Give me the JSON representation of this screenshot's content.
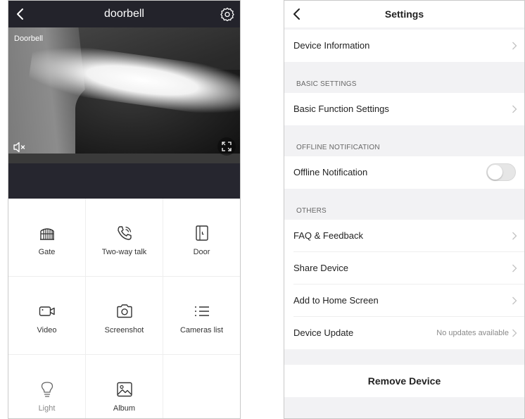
{
  "camera": {
    "title": "doorbell",
    "stream_label": "Doorbell",
    "controls": [
      {
        "label": "Gate",
        "icon": "gate-icon"
      },
      {
        "label": "Two-way talk",
        "icon": "phone-talk-icon"
      },
      {
        "label": "Door",
        "icon": "door-icon"
      },
      {
        "label": "Video",
        "icon": "video-camera-icon"
      },
      {
        "label": "Screenshot",
        "icon": "camera-icon"
      },
      {
        "label": "Cameras list",
        "icon": "list-icon"
      },
      {
        "label": "Light",
        "icon": "light-bulb-icon"
      },
      {
        "label": "Album",
        "icon": "image-icon"
      }
    ]
  },
  "settings": {
    "title": "Settings",
    "device_information": "Device Information",
    "sections": {
      "basic": "BASIC SETTINGS",
      "offline": "OFFLINE NOTIFICATION",
      "others": "OTHERS"
    },
    "basic_function": "Basic Function Settings",
    "offline_notification": {
      "label": "Offline Notification",
      "enabled": false
    },
    "faq": "FAQ & Feedback",
    "share": "Share Device",
    "add_home": "Add to Home Screen",
    "update": {
      "label": "Device Update",
      "status": "No updates available"
    },
    "remove": "Remove Device"
  },
  "colors": {
    "camera_bar": "#23232b",
    "settings_bg": "#f2f2f4",
    "toggle_off": "#e6e6e6"
  }
}
